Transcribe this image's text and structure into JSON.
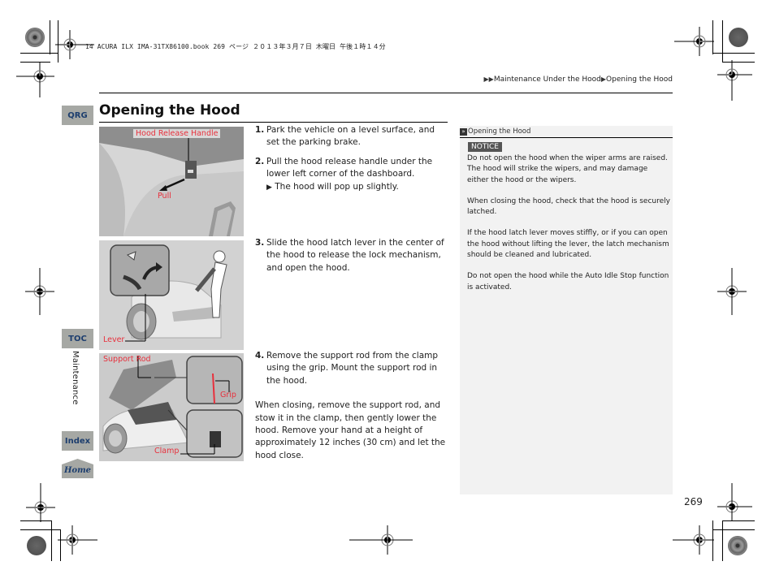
{
  "print_header": "14 ACURA ILX IMA-31TX86100.book  269 ページ  ２０１３年３月７日  木曜日  午後１時１４分",
  "breadcrumb": {
    "items": [
      "Maintenance Under the Hood",
      "Opening the Hood"
    ],
    "separator_icon": "triangle-right-icon"
  },
  "side_nav": {
    "qrg": "QRG",
    "toc": "TOC",
    "section": "Maintenance",
    "index": "Index",
    "home": "Home"
  },
  "page_title": "Opening the Hood",
  "figures": [
    {
      "name": "hood-release-handle-figure",
      "labels": [
        "Hood Release Handle",
        "Pull"
      ]
    },
    {
      "name": "hood-latch-lever-figure",
      "labels": [
        "Lever"
      ]
    },
    {
      "name": "support-rod-figure",
      "labels": [
        "Support Rod",
        "Grip",
        "Clamp"
      ]
    }
  ],
  "steps": [
    {
      "num": "1.",
      "text": "Park the vehicle on a level surface, and set the parking brake."
    },
    {
      "num": "2.",
      "text": "Pull the hood release handle under the lower left corner of the dashboard.",
      "sub": "The hood will pop up slightly."
    },
    {
      "num": "3.",
      "text": "Slide the hood latch lever in the center of the hood to release the lock mechanism, and open the hood."
    },
    {
      "num": "4.",
      "text": "Remove the support rod from the clamp using the grip. Mount the support rod in the hood."
    }
  ],
  "closing_text": "When closing, remove the support rod, and stow it in the clamp, then gently lower the hood. Remove your hand at a height of approximately 12 inches (30 cm) and let the hood close.",
  "note": {
    "header": "Opening the Hood",
    "badge": "NOTICE",
    "paragraphs": [
      "Do not open the hood when the wiper arms are raised.\nThe hood will strike the wipers, and may damage either the hood or the wipers.",
      "When closing the hood, check that the hood is securely latched.",
      "If the hood latch lever moves stiffly, or if you can open the hood without lifting the lever, the latch mechanism should be cleaned and lubricated.",
      "Do not open the hood while the Auto Idle Stop function is activated."
    ]
  },
  "page_number": "269",
  "colors": {
    "nav_button_bg": "#a6a8a4",
    "nav_button_text": "#1d3e6e",
    "figure_label": "#e8303c",
    "note_panel_bg": "#f2f2f2",
    "notice_badge_bg": "#555555"
  }
}
